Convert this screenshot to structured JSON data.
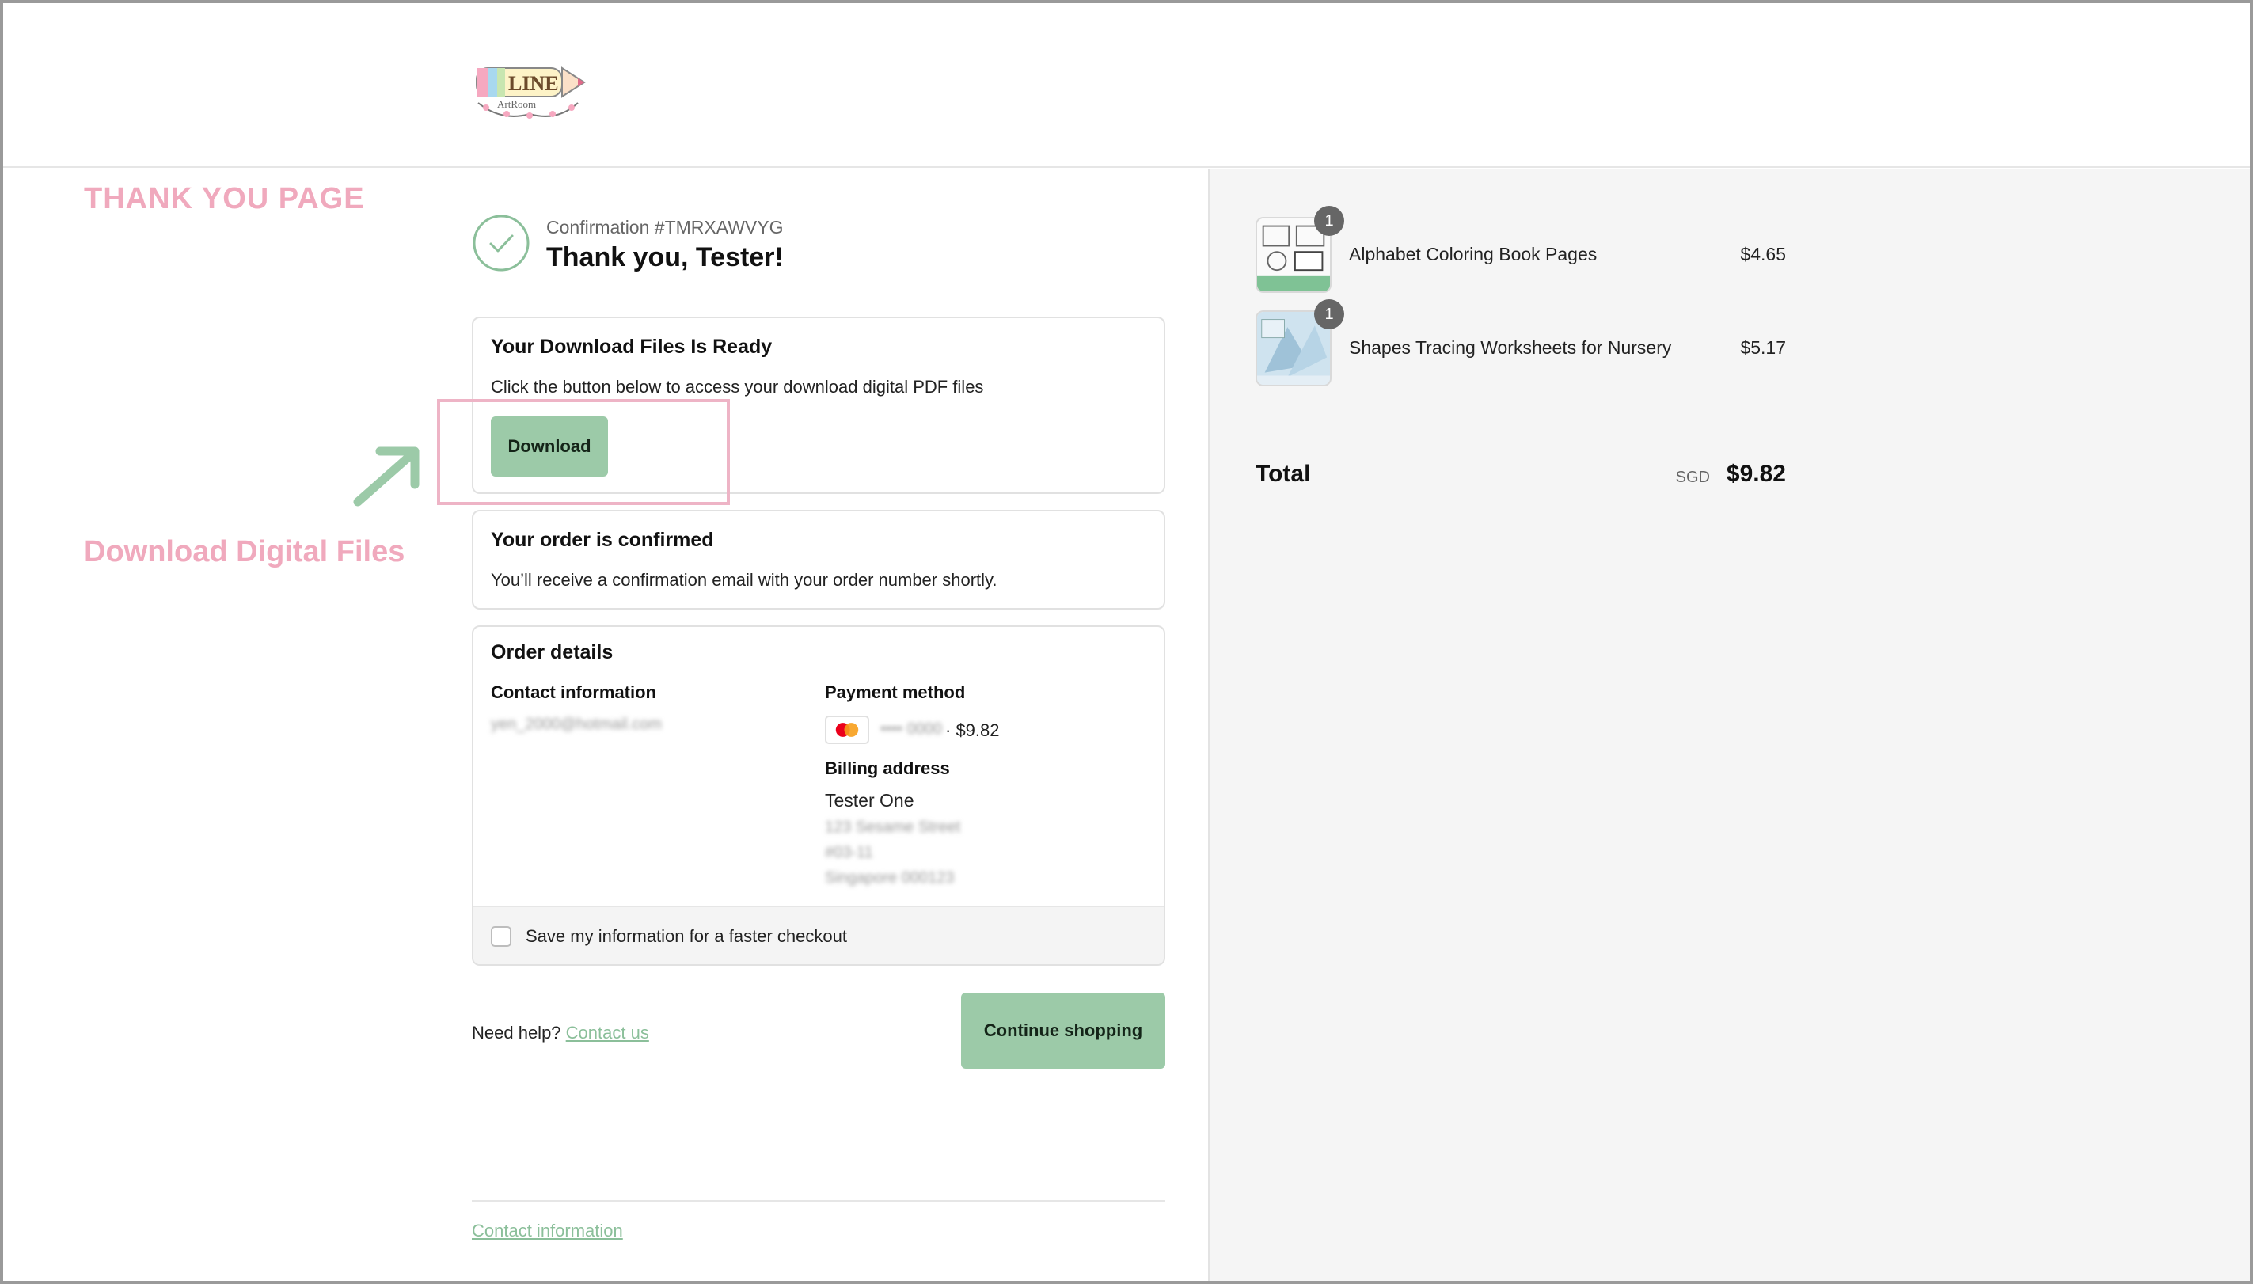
{
  "annotations": {
    "title": "THANK YOU PAGE",
    "download_label": "Download Digital Files"
  },
  "header": {
    "logo_text": "LINE ArtRoom"
  },
  "confirmation": {
    "number": "Confirmation #TMRXAWVYG",
    "thanks": "Thank you, Tester!"
  },
  "download_card": {
    "title": "Your Download Files Is Ready",
    "text": "Click the button below to access your download digital PDF files",
    "button_label": "Download"
  },
  "confirmed_card": {
    "title": "Your order is confirmed",
    "text": "You’ll receive a confirmation email with your order number shortly."
  },
  "order_details": {
    "title": "Order details",
    "contact_label": "Contact information",
    "contact_email": "yen_2000@hotmail.com",
    "payment_label": "Payment method",
    "payment_masked": "•••• 0000",
    "payment_amount": "· $9.82",
    "billing_label": "Billing address",
    "billing_name": "Tester One",
    "billing_lines": [
      "123 Sesame Street",
      "#03-11",
      "Singapore 000123"
    ],
    "save_label": "Save my information for a faster checkout"
  },
  "help": {
    "prefix": "Need help?",
    "link": "Contact us",
    "continue_label": "Continue shopping"
  },
  "footer": {
    "link": "Contact information"
  },
  "summary": {
    "items": [
      {
        "name": "Alphabet Coloring Book Pages",
        "price": "$4.65",
        "qty": "1"
      },
      {
        "name": "Shapes Tracing Worksheets for Nursery",
        "price": "$5.17",
        "qty": "1"
      }
    ],
    "total_label": "Total",
    "currency": "SGD",
    "total_value": "$9.82"
  },
  "colors": {
    "accent_green": "#9ccaa8",
    "link_green": "#8bbf9a",
    "annotation_pink": "#f0a9bd"
  }
}
